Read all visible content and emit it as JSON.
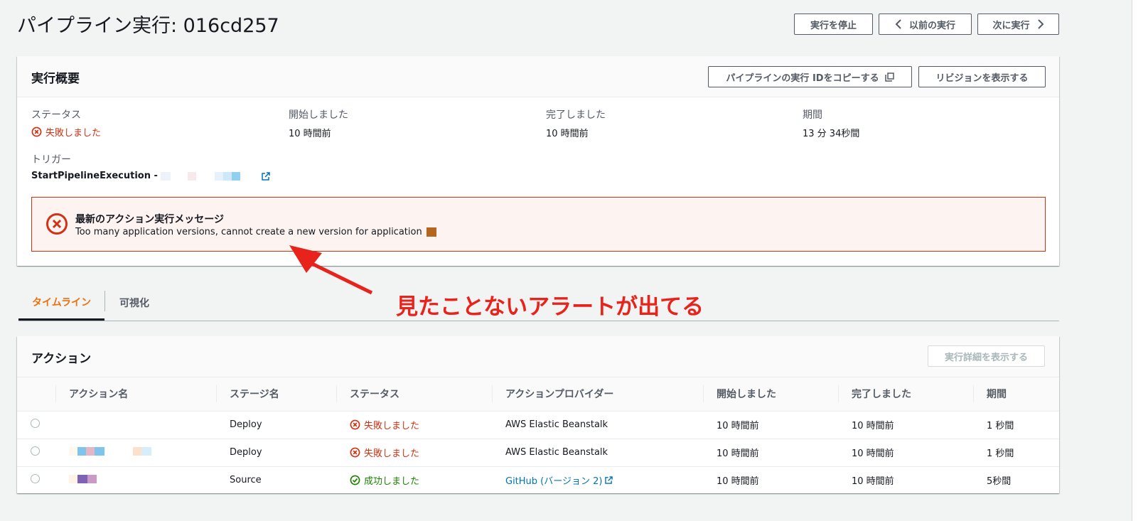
{
  "header": {
    "title": "パイプライン実行: 016cd257",
    "stop_label": "実行を停止",
    "prev_label": "以前の実行",
    "next_label": "次に実行"
  },
  "summary": {
    "title": "実行概要",
    "copy_id_label": "パイプラインの実行 IDをコピーする",
    "show_revision_label": "リビジョンを表示する",
    "status_label": "ステータス",
    "status_value": "失敗しました",
    "started_label": "開始しました",
    "started_value": "10 時間前",
    "completed_label": "完了しました",
    "completed_value": "10 時間前",
    "duration_label": "期間",
    "duration_value": "13 分 34秒間",
    "trigger_label": "トリガー",
    "trigger_value": "StartPipelineExecution -"
  },
  "alert": {
    "title": "最新のアクション実行メッセージ",
    "message": "Too many application versions, cannot create a new version for application"
  },
  "annotation": {
    "text": "見たことないアラートが出てる",
    "color": "#e8231c"
  },
  "tabs": [
    {
      "label": "タイムライン",
      "active": true
    },
    {
      "label": "可視化",
      "active": false
    }
  ],
  "actions": {
    "title": "アクション",
    "details_label": "実行詳細を表示する",
    "columns": [
      "アクション名",
      "ステージ名",
      "ステータス",
      "アクションプロバイダー",
      "開始しました",
      "完了しました",
      "期間"
    ],
    "rows": [
      {
        "stage": "Deploy",
        "status": "失敗しました",
        "status_type": "failed",
        "provider": "AWS Elastic Beanstalk",
        "started": "10 時間前",
        "completed": "10 時間前",
        "duration": "1 秒間"
      },
      {
        "stage": "Deploy",
        "status": "失敗しました",
        "status_type": "failed",
        "provider": "AWS Elastic Beanstalk",
        "started": "10 時間前",
        "completed": "10 時間前",
        "duration": "1 秒間"
      },
      {
        "stage": "Source",
        "status": "成功しました",
        "status_type": "succeeded",
        "provider": "GitHub (バージョン 2)",
        "started": "10 時間前",
        "completed": "10 時間前",
        "duration": "5秒間"
      }
    ]
  },
  "colors": {
    "error": "#d13212",
    "success": "#1d8102",
    "link": "#0073bb",
    "tab_active": "#ec7211"
  },
  "icons": [
    "copy-icon",
    "external-link-icon",
    "error-circle-icon",
    "success-check-icon",
    "chevron-left-icon",
    "chevron-right-icon"
  ]
}
